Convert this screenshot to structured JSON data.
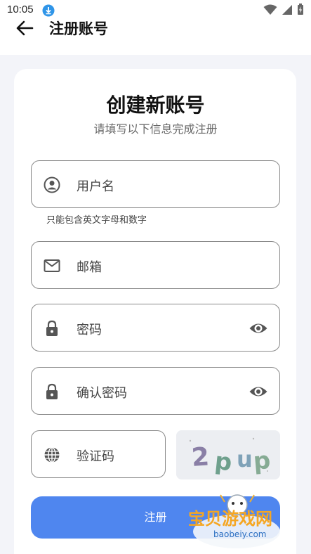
{
  "status_bar": {
    "time": "10:05"
  },
  "header": {
    "title": "注册账号"
  },
  "card": {
    "title": "创建新账号",
    "subtitle": "请填写以下信息完成注册"
  },
  "fields": {
    "username": {
      "placeholder": "用户名",
      "hint": "只能包含英文字母和数字"
    },
    "email": {
      "placeholder": "邮箱"
    },
    "password": {
      "placeholder": "密码"
    },
    "confirm_password": {
      "placeholder": "确认密码"
    },
    "captcha": {
      "placeholder": "验证码",
      "image_text": "2pup"
    }
  },
  "register_button": {
    "label": "注册"
  },
  "watermark": {
    "title": "宝贝游戏网",
    "url": "baobeiy.com"
  },
  "colors": {
    "accent": "#4f86ef",
    "background": "#f3f4f9"
  }
}
